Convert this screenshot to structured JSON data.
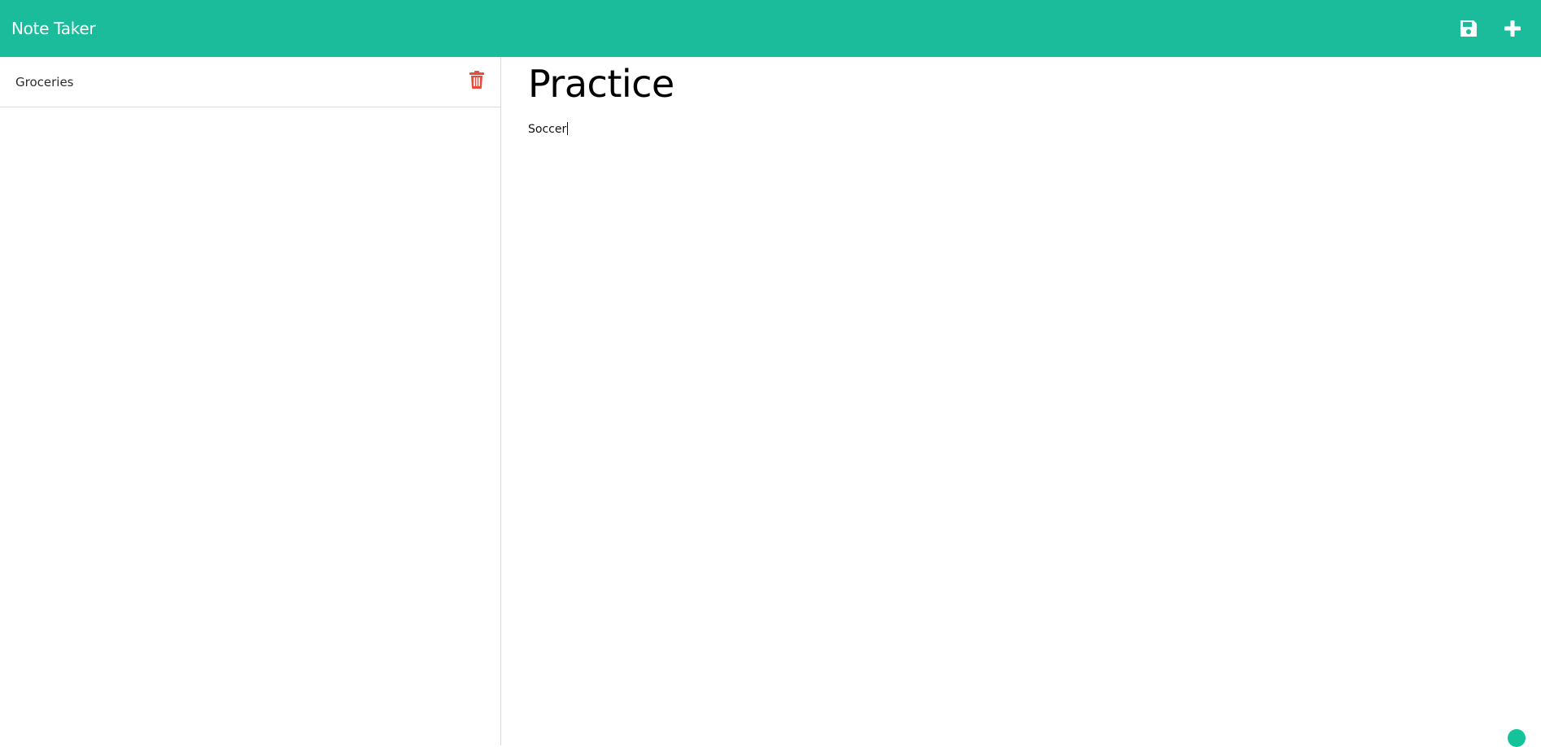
{
  "navbar": {
    "brand": "Note Taker",
    "bg_color": "#1abc9c",
    "icons": [
      "save-icon",
      "plus-icon"
    ]
  },
  "sidebar": {
    "items": [
      {
        "label": "Groceries",
        "action_icon": "trash-icon",
        "action_color": "#e74c3c"
      }
    ]
  },
  "editor": {
    "title_value": "Practice",
    "text_value": "Soccer"
  },
  "assistant_widget": {
    "icon": "grammarly-icon",
    "color": "#15c39a"
  }
}
